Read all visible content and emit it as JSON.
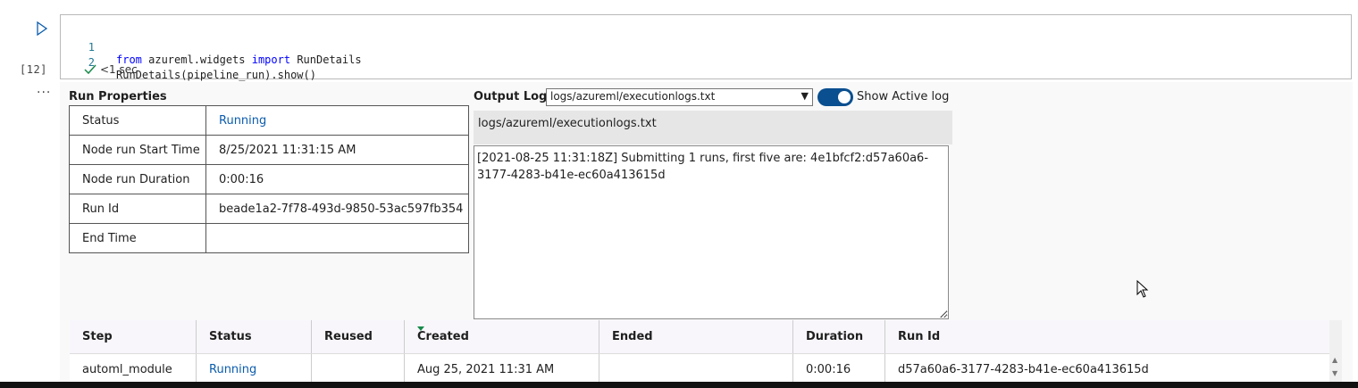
{
  "cell": {
    "execution_count": "[12]",
    "more_label": "···",
    "run_icon": "play-icon",
    "lines": [
      {
        "num": "1",
        "kw1": "from",
        "mid": " azureml.widgets ",
        "kw2": "import",
        "rest": " RunDetails"
      },
      {
        "num": "2",
        "text": "RunDetails(pipeline_run).show()"
      }
    ],
    "status_icon": "checkmark-icon",
    "status_text": "<1 sec"
  },
  "run_properties": {
    "title": "Run Properties",
    "rows": [
      {
        "key": "Status",
        "value": "Running"
      },
      {
        "key": "Node run Start Time",
        "value": "8/25/2021 11:31:15 AM"
      },
      {
        "key": "Node run Duration",
        "value": "0:00:16"
      },
      {
        "key": "Run Id",
        "value": "beade1a2-7f78-493d-9850-53ac597fb354"
      },
      {
        "key": "End Time",
        "value": ""
      }
    ]
  },
  "output_logs": {
    "label": "Output Logs",
    "selected": "logs/azureml/executionlogs.txt",
    "toggle_label": "Show Active log",
    "toggle_on": true,
    "path": "logs/azureml/executionlogs.txt",
    "content": "[2021-08-25 11:31:18Z] Submitting 1 runs, first five are: 4e1bfcf2:d57a60a6-3177-4283-b41e-ec60a413615d"
  },
  "steps_table": {
    "headers": [
      "Step",
      "Status",
      "Reused",
      "Created",
      "Ended",
      "Duration",
      "Run Id"
    ],
    "rows": [
      [
        "automl_module",
        "Running",
        "",
        "Aug 25, 2021 11:31 AM",
        "",
        "0:00:16",
        "d57a60a6-3177-4283-b41e-ec60a413615d"
      ]
    ]
  },
  "colors": {
    "accent": "#0a4f8f",
    "link": "#0b5cad",
    "sort_indicator": "#178a4a"
  }
}
